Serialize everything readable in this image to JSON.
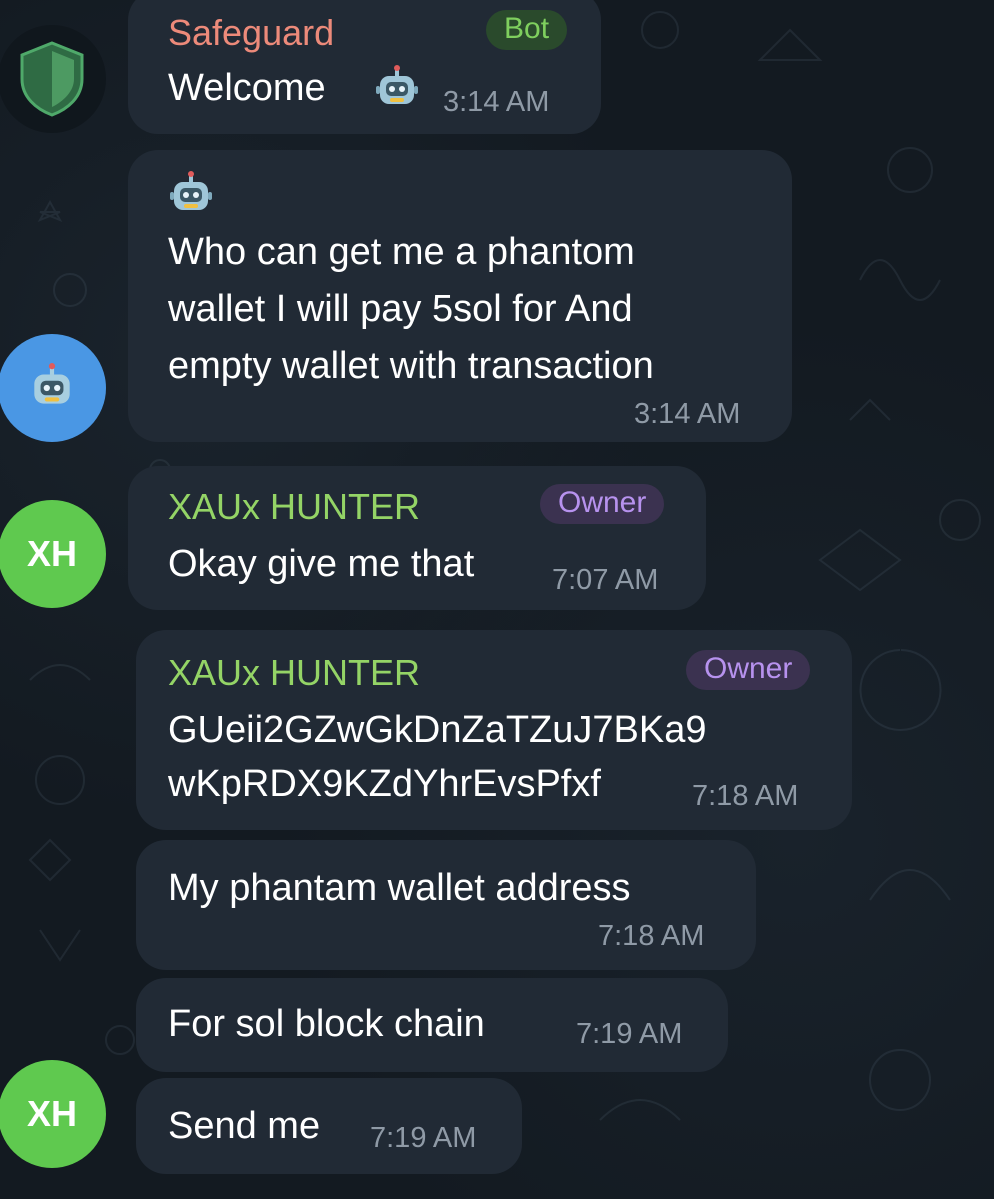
{
  "messages": [
    {
      "sender": "Safeguard",
      "role": "Bot",
      "text": "Welcome",
      "time": "3:14 AM"
    },
    {
      "text_lines": [
        "Who can get me a phantom",
        "wallet I will pay 5sol for And",
        "empty wallet with transaction"
      ],
      "time": "3:14 AM"
    },
    {
      "sender": "XAUx HUNTER",
      "role": "Owner",
      "text": "Okay give me that",
      "time": "7:07 AM"
    },
    {
      "sender": "XAUx HUNTER",
      "role": "Owner",
      "text_lines": [
        "GUeii2GZwGkDnZaTZuJ7BKa9",
        "wKpRDX9KZdYhrEvsPfxf"
      ],
      "time": "7:18 AM"
    },
    {
      "text": "My phantam wallet address",
      "time": "7:18 AM"
    },
    {
      "text": "For sol block chain",
      "time": "7:19 AM"
    },
    {
      "text": "Send me",
      "time": "7:19 AM"
    }
  ],
  "avatars": {
    "safeguard_icon": "shield-icon",
    "robot_icon": "robot-icon",
    "xh_initials": "XH"
  },
  "colors": {
    "background": "#131a21",
    "bubble": "#212a35",
    "safeguard_name": "#ec8a7a",
    "hunter_name": "#94d466",
    "bot_badge": "#7fcf5e",
    "owner_badge": "#b792ee",
    "time": "#8f9aa6",
    "xh_avatar": "#5fc94f",
    "robot_avatar": "#4a97e4"
  }
}
